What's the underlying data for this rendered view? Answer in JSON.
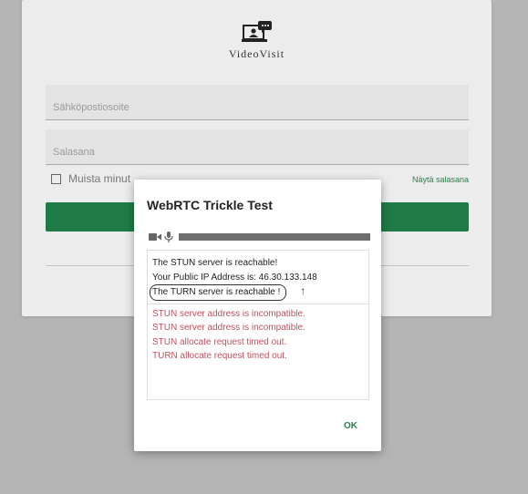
{
  "login": {
    "brand": "VideoVisit",
    "email_placeholder": "Sähköpostiosoite",
    "password_placeholder": "Salasana",
    "remember_label": "Muista minut",
    "show_password_link": "Näytä salasana"
  },
  "dialog": {
    "title": "WebRTC Trickle Test",
    "media_level": 1.0,
    "log_success": [
      "The STUN server is reachable!",
      "Your Public IP Address is: 46.30.133.148",
      "The TURN server is reachable !"
    ],
    "annotation_mark": "↑",
    "log_errors": [
      "STUN server address is incompatible.",
      "STUN server address is incompatible.",
      "STUN allocate request timed out.",
      "TURN allocate request timed out."
    ],
    "ok_label": "OK"
  },
  "colors": {
    "accent_green": "#1f7b45",
    "error_red": "#c0505c"
  },
  "icons": [
    "videovisit-logo-icon",
    "camera-icon",
    "microphone-icon"
  ]
}
